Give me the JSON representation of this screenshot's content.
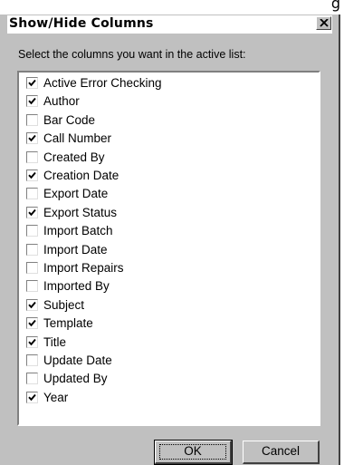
{
  "window": {
    "title": "Show/Hide Columns",
    "edge_glyph": "g"
  },
  "instruction": "Select the columns you want in the active list:",
  "columns": [
    {
      "label": "Active Error Checking",
      "checked": true
    },
    {
      "label": "Author",
      "checked": true
    },
    {
      "label": "Bar Code",
      "checked": false
    },
    {
      "label": "Call Number",
      "checked": true
    },
    {
      "label": "Created By",
      "checked": false
    },
    {
      "label": "Creation Date",
      "checked": true
    },
    {
      "label": "Export Date",
      "checked": false
    },
    {
      "label": "Export Status",
      "checked": true
    },
    {
      "label": "Import Batch",
      "checked": false
    },
    {
      "label": "Import Date",
      "checked": false
    },
    {
      "label": "Import Repairs",
      "checked": false
    },
    {
      "label": "Imported By",
      "checked": false
    },
    {
      "label": "Subject",
      "checked": true
    },
    {
      "label": "Template",
      "checked": true
    },
    {
      "label": "Title",
      "checked": true
    },
    {
      "label": "Update Date",
      "checked": false
    },
    {
      "label": "Updated By",
      "checked": false
    },
    {
      "label": "Year",
      "checked": true
    }
  ],
  "buttons": {
    "ok": "OK",
    "cancel": "Cancel"
  },
  "icons": {
    "close": "close-icon",
    "check": "check-icon"
  }
}
